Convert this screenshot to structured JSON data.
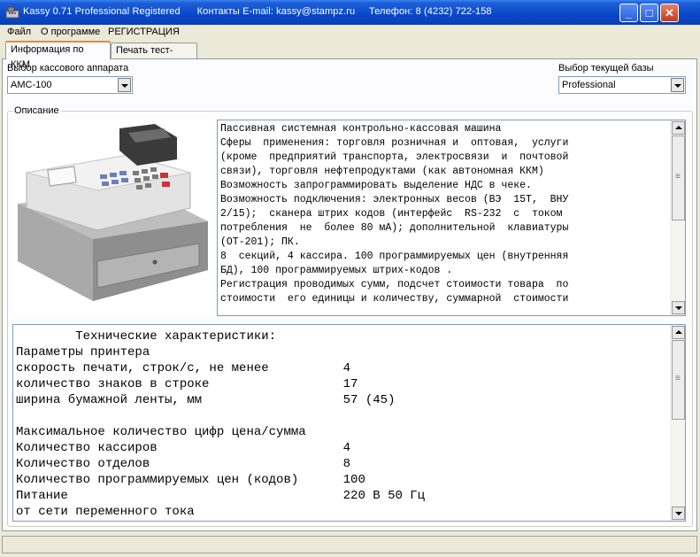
{
  "window": {
    "title": "Kassy 0.71 Professional Registered      Контакты E-mail: kassy@stampz.ru     Телефон: 8 (4232) 722-158"
  },
  "menu": [
    "Файл",
    "О программе",
    "РЕГИСТРАЦИЯ"
  ],
  "tabs": [
    "Информация по ККМ",
    "Печать тест-чека"
  ],
  "device_select": {
    "label": "Выбор кассового аппарата",
    "value": "АМС-100"
  },
  "base_select": {
    "label": "Выбор текущей базы",
    "value": "Professional"
  },
  "description": {
    "group_title": "Описание",
    "lines": [
      "Пассивная системная контрольно-кассовая машина",
      "Сферы  применения: торговля розничная и  оптовая,  услуги",
      "(кроме  предприятий транспорта, электросвязи  и  почтовой",
      "связи), торговля нефтепродуктами (как автономная ККМ)",
      "Возможность запрограммировать выделение НДС в чеке.",
      "Возможность подключения: электронных весов (ВЭ  15Т,  ВНУ",
      "2/15);  сканера штрих кодов (интерфейс  RS-232  с  током",
      "потребления  не  более 80 мА); дополнительной  клавиатуры",
      "(ОТ-201); ПК.",
      "8  секций, 4 кассира. 100 программируемых цен (внутренняя",
      "БД), 100 программируемых штрих-кодов .",
      "Регистрация проводимых сумм, подсчет стоимости товара  по",
      "стоимости  его единицы и количеству, суммарной  стоимости"
    ]
  },
  "specs": {
    "lines": [
      "        Технические характеристики:",
      "Параметры принтера",
      "скорость печати, строк/с, не менее          4",
      "количество знаков в строке                  17",
      "ширина бумажной ленты, мм                   57 (45)",
      "",
      "Максимальное количество цифр цена/сумма",
      "Количество кассиров                         4",
      "Количество отделов                          8",
      "Количество программируемых цен (кодов)      100",
      "Питание                                     220 В 50 Гц",
      "от сети переменного тока"
    ]
  },
  "colors": {
    "titlebar": "#0A47C8",
    "tab_highlight": "#E68B2C",
    "window_bg": "#ECE9D8"
  },
  "icons": [
    "app-icon",
    "minimize-icon",
    "maximize-icon",
    "close-icon",
    "chevron-down-icon",
    "cash-register-image"
  ]
}
